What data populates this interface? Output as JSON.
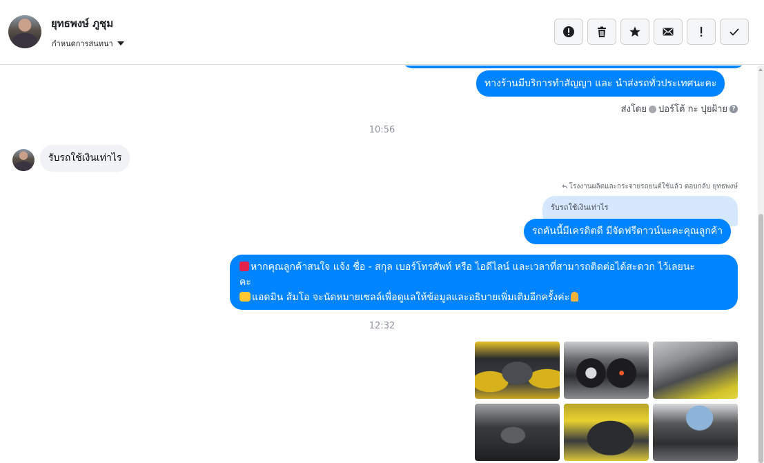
{
  "header": {
    "contact_name": "ยุทธพงษ์ ภูชุม",
    "conversation_settings": "กำหนดการสนทนา",
    "toolbar": [
      {
        "name": "spam-alert-button",
        "icon": "alert-circle-icon"
      },
      {
        "name": "delete-button",
        "icon": "trash-icon"
      },
      {
        "name": "star-button",
        "icon": "star-icon"
      },
      {
        "name": "mark-unread-button",
        "icon": "envelope-icon"
      },
      {
        "name": "follow-up-button",
        "icon": "exclamation-icon"
      },
      {
        "name": "mark-done-button",
        "icon": "check-icon"
      }
    ]
  },
  "thread": {
    "msg1": "ทางร้านมีบริการทำสัญญา และ นำส่งรถทั่วประเทศนะคะ",
    "sent_by_prefix": "ส่งโดย",
    "sent_by_name": "ปอร์โต้ กะ ปุยฝ้าย",
    "time1": "10:56",
    "incoming": "รับรถใช้เงินเท่าไร",
    "reply_header": "โรงงานผลิตและกระจายรถยนต์ใช้แล้ว ตอบกลับ ยุทธพงษ์",
    "reply_quote": "รับรถใช้เงินเท่าไร",
    "reply_text": "รถคันนี้มีเครดิตดี มีจัดฟรีดาวน์นะคะคุณลูกค้า",
    "long_line1": "หากคุณลูกค้าสนใจ แจ้ง ชื่อ - สกุล เบอร์โทรศัพท์ หรือ ไอดีไลน์ และเวลาที่สามารถติดต่อได้สะดวก ไว้เลยนะ",
    "long_line2": "คะ",
    "long_line3": "แอดมิน ส้มโอ จะนัดหมายเซลล์เพื่อดูแลให้ข้อมูลและอธิบายเพิ่มเติมอีกครั้งค่ะ",
    "time2": "12:32"
  },
  "photos": [
    {
      "name": "photo-engine-bay"
    },
    {
      "name": "photo-instrument-cluster"
    },
    {
      "name": "photo-door-panel"
    },
    {
      "name": "photo-gear-shifter"
    },
    {
      "name": "photo-rear-seats"
    },
    {
      "name": "photo-dashboard"
    }
  ],
  "colors": {
    "accent": "#0084ff",
    "incoming_bubble": "#f0f2f5",
    "quote_bubble": "#d6e8fd"
  }
}
